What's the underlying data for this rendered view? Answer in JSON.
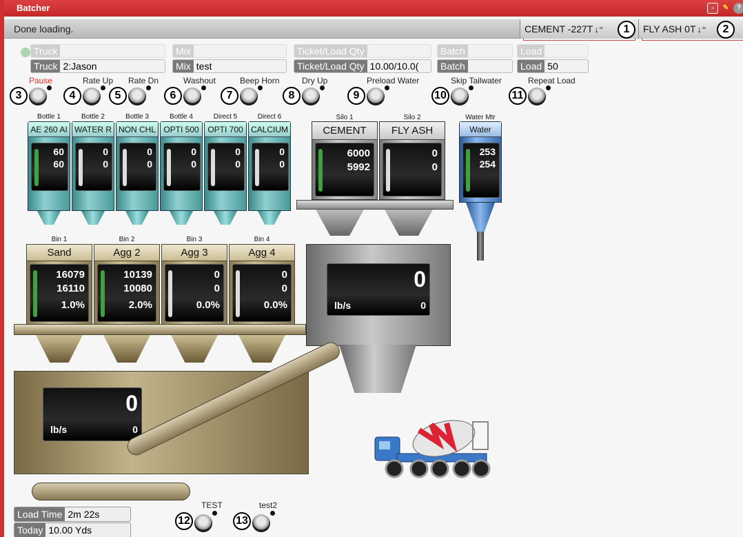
{
  "window": {
    "title": "Batcher"
  },
  "status": {
    "message": "Done loading."
  },
  "materials": [
    {
      "label": "CEMENT -227T",
      "callout": "1"
    },
    {
      "label": "FLY ASH 0T",
      "callout": "2"
    }
  ],
  "fields_ghost": [
    {
      "label": "Truck",
      "value": ""
    },
    {
      "label": "Mix",
      "value": ""
    },
    {
      "label": "Ticket/Load Qty",
      "value": ""
    },
    {
      "label": "Batch",
      "value": ""
    },
    {
      "label": "Load",
      "value": ""
    }
  ],
  "fields": [
    {
      "label": "Truck",
      "value": "2:Jason"
    },
    {
      "label": "Mix",
      "value": "test"
    },
    {
      "label": "Ticket/Load Qty",
      "value": "10.00/10.0("
    },
    {
      "label": "Batch",
      "value": ""
    },
    {
      "label": "Load",
      "value": "50"
    }
  ],
  "controls": [
    {
      "label": "Pause",
      "callout": "3",
      "color": "#e0302a"
    },
    {
      "label": "Rate Up",
      "callout": "4"
    },
    {
      "label": "Rate Dn",
      "callout": "5"
    },
    {
      "label": "Washout",
      "callout": "6"
    },
    {
      "label": "Beep Horn",
      "callout": "7"
    },
    {
      "label": "Dry Up",
      "callout": "8"
    },
    {
      "label": "Preload Water",
      "callout": "9"
    },
    {
      "label": "Skip Tailwater",
      "callout": "10"
    },
    {
      "label": "Repeat Load",
      "callout": "11"
    }
  ],
  "bottles": [
    {
      "label": "Bottle 1",
      "name": "AE 260 AI",
      "target": "60",
      "actual": "60",
      "level": 0.85
    },
    {
      "label": "Bottle 2",
      "name": "WATER R",
      "target": "0",
      "actual": "0",
      "level": 0
    },
    {
      "label": "Bottle 3",
      "name": "NON CHL",
      "target": "0",
      "actual": "0",
      "level": 0
    },
    {
      "label": "Bottle 4",
      "name": "OPTI 500",
      "target": "0",
      "actual": "0",
      "level": 0
    },
    {
      "label": "Direct 5",
      "name": "OPTI 700",
      "target": "0",
      "actual": "0",
      "level": 0
    },
    {
      "label": "Direct 6",
      "name": "CALCIUM",
      "target": "0",
      "actual": "0",
      "level": 0
    }
  ],
  "silos": [
    {
      "label": "Silo 1",
      "name": "CEMENT",
      "target": "6000",
      "actual": "5992",
      "level": 0.85
    },
    {
      "label": "Silo 2",
      "name": "FLY ASH",
      "target": "0",
      "actual": "0",
      "level": 0
    }
  ],
  "water": {
    "label": "Water Mtr",
    "name": "Water",
    "target": "253",
    "actual": "254",
    "level": 0.85
  },
  "bins": [
    {
      "label": "Bin 1",
      "name": "Sand",
      "target": "16079",
      "actual": "16110",
      "pct": "1.0%",
      "level": 0.85
    },
    {
      "label": "Bin 2",
      "name": "Agg 2",
      "target": "10139",
      "actual": "10080",
      "pct": "2.0%",
      "level": 0.85
    },
    {
      "label": "Bin 3",
      "name": "Agg 3",
      "target": "0",
      "actual": "0",
      "pct": "0.0%",
      "level": 0
    },
    {
      "label": "Bin 4",
      "name": "Agg 4",
      "target": "0",
      "actual": "0",
      "pct": "0.0%",
      "level": 0
    }
  ],
  "cement_scale": {
    "value": "0",
    "rate_label": "lb/s",
    "rate": "0"
  },
  "agg_scale": {
    "value": "0",
    "rate_label": "lb/s",
    "rate": "0"
  },
  "footer": {
    "load_time_label": "Load Time",
    "load_time": "2m 22s",
    "today_label": "Today",
    "today": "10.00 Yds"
  },
  "tests": [
    {
      "label": "TEST",
      "callout": "12"
    },
    {
      "label": "test2",
      "callout": "13"
    }
  ]
}
